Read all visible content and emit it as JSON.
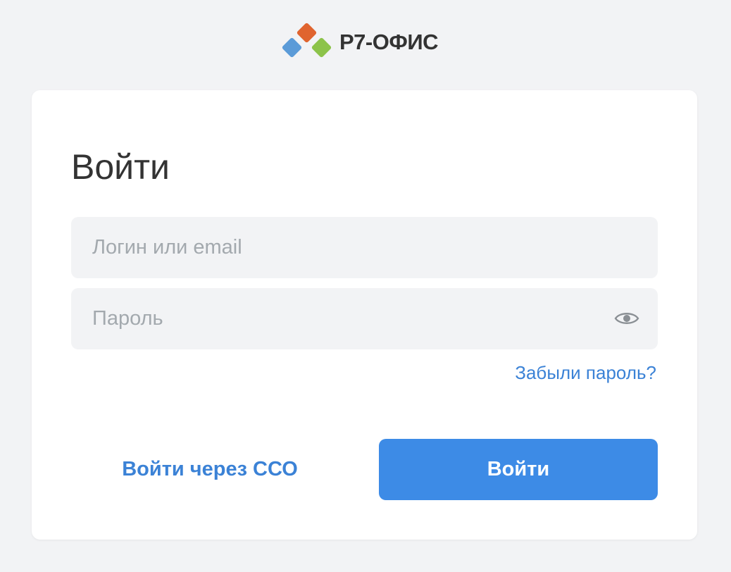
{
  "brand": {
    "name": "Р7-ОФИС",
    "logo_icon": "r7-office-logo-icon",
    "logo_colors": [
      "#e0642f",
      "#5b9bd8",
      "#8cc34a"
    ]
  },
  "login_form": {
    "title": "Войти",
    "login_field": {
      "placeholder": "Логин или email",
      "value": ""
    },
    "password_field": {
      "placeholder": "Пароль",
      "value": "",
      "toggle_icon": "eye-icon"
    },
    "forgot_password_link": "Забыли пароль?",
    "sso_button": "Войти через ССО",
    "submit_button": "Войти"
  },
  "colors": {
    "background": "#f2f3f5",
    "card": "#ffffff",
    "accent": "#3d8be6",
    "link": "#3b82d6",
    "text": "#333333",
    "placeholder": "#a3a9ae"
  }
}
